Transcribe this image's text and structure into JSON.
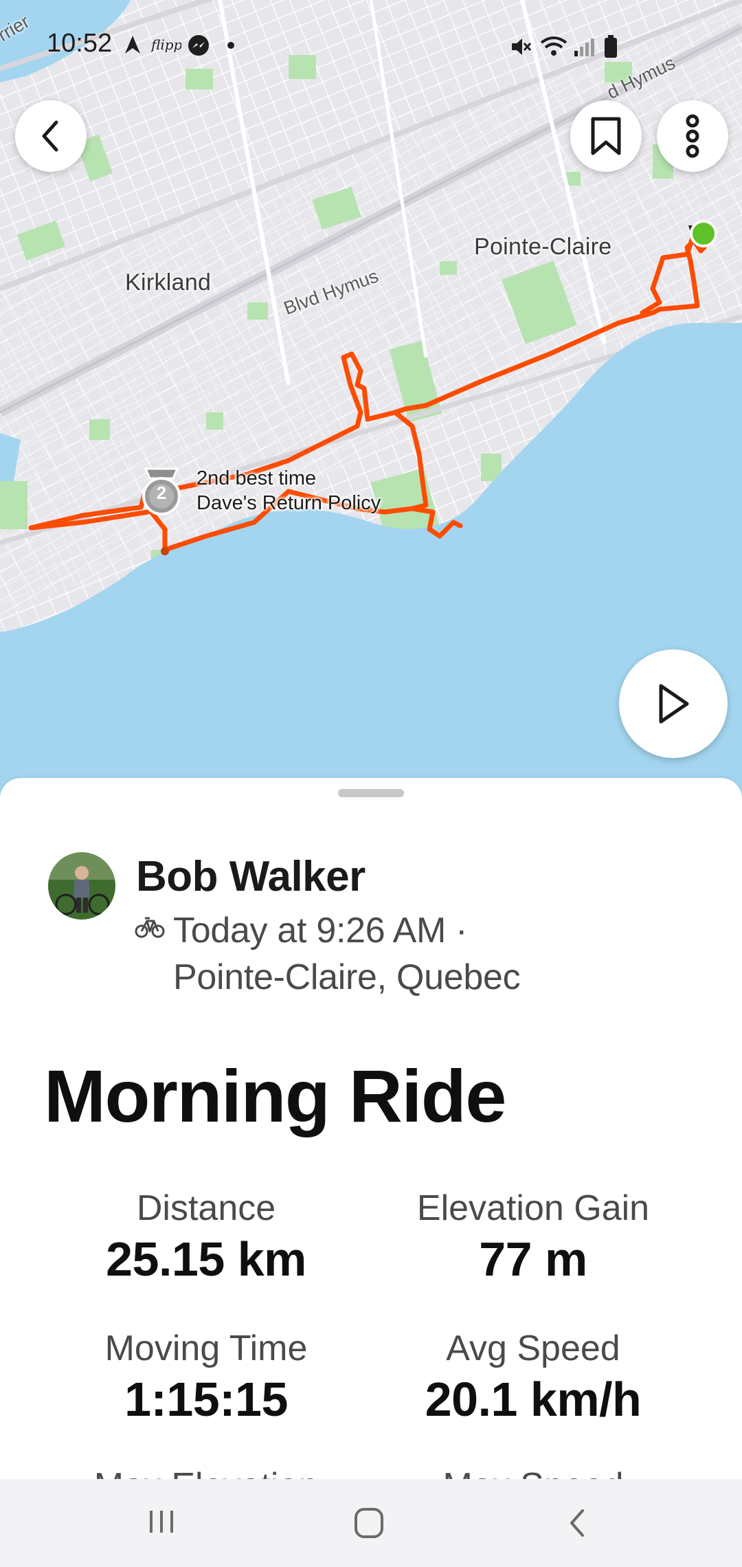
{
  "status_bar": {
    "time": "10:52",
    "left_icons": [
      "navigation-arrow-icon",
      "flipp-app-icon",
      "messenger-icon",
      "dot-icon"
    ],
    "right_icons": [
      "mute-icon",
      "wifi-icon",
      "signal-icon",
      "battery-icon"
    ]
  },
  "map": {
    "place_labels": [
      "Kirkland",
      "Pointe-Claire"
    ],
    "road_labels": [
      "Blvd Hymus",
      "d Hymus",
      "rrier"
    ],
    "segment": {
      "rank": "2",
      "achievement": "2nd best time",
      "name": "Dave's Return Policy"
    },
    "colors": {
      "route": "#fc4c02",
      "water": "#a3d5f0",
      "park": "#b7e3b0",
      "land": "#eeedf1",
      "start_marker": "#5ec128"
    }
  },
  "toolbar": {
    "back_icon": "chevron-left-icon",
    "bookmark_icon": "bookmark-icon",
    "more_icon": "more-vertical-icon",
    "play_icon": "play-icon"
  },
  "activity": {
    "athlete_name": "Bob Walker",
    "sport_icon": "bike-icon",
    "date_line": "Today at 9:26 AM ·",
    "location_line": "Pointe-Claire, Quebec",
    "title": "Morning Ride",
    "stats": [
      {
        "label": "Distance",
        "value": "25.15 km"
      },
      {
        "label": "Elevation Gain",
        "value": "77 m"
      },
      {
        "label": "Moving Time",
        "value": "1:15:15"
      },
      {
        "label": "Avg Speed",
        "value": "20.1 km/h"
      },
      {
        "label": "Max Elevation",
        "value": ""
      },
      {
        "label": "Max Speed",
        "value": ""
      }
    ]
  },
  "nav_bar": {
    "icons": [
      "recent-apps-icon",
      "home-icon",
      "back-icon"
    ]
  }
}
